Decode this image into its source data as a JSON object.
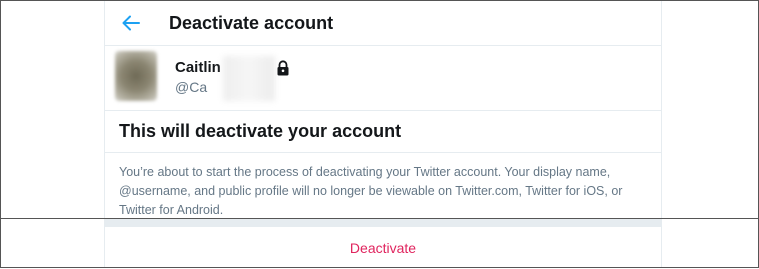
{
  "header": {
    "title": "Deactivate account"
  },
  "profile": {
    "name": "Caitlin",
    "handle": "@Ca"
  },
  "warning": {
    "title": "This will deactivate your account",
    "description": "You’re about to start the process of deactivating your Twitter account. Your display name, @username, and public profile will no longer be viewable on Twitter.com, Twitter for iOS, or Twitter for Android."
  },
  "actions": {
    "deactivate_label": "Deactivate"
  },
  "colors": {
    "accent": "#1da1f2",
    "danger": "#e0245e",
    "text_primary": "#14171a",
    "text_secondary": "#657786",
    "divider": "#e6ecf0"
  },
  "icons": {
    "back": "arrow-left-icon",
    "lock": "lock-icon"
  }
}
